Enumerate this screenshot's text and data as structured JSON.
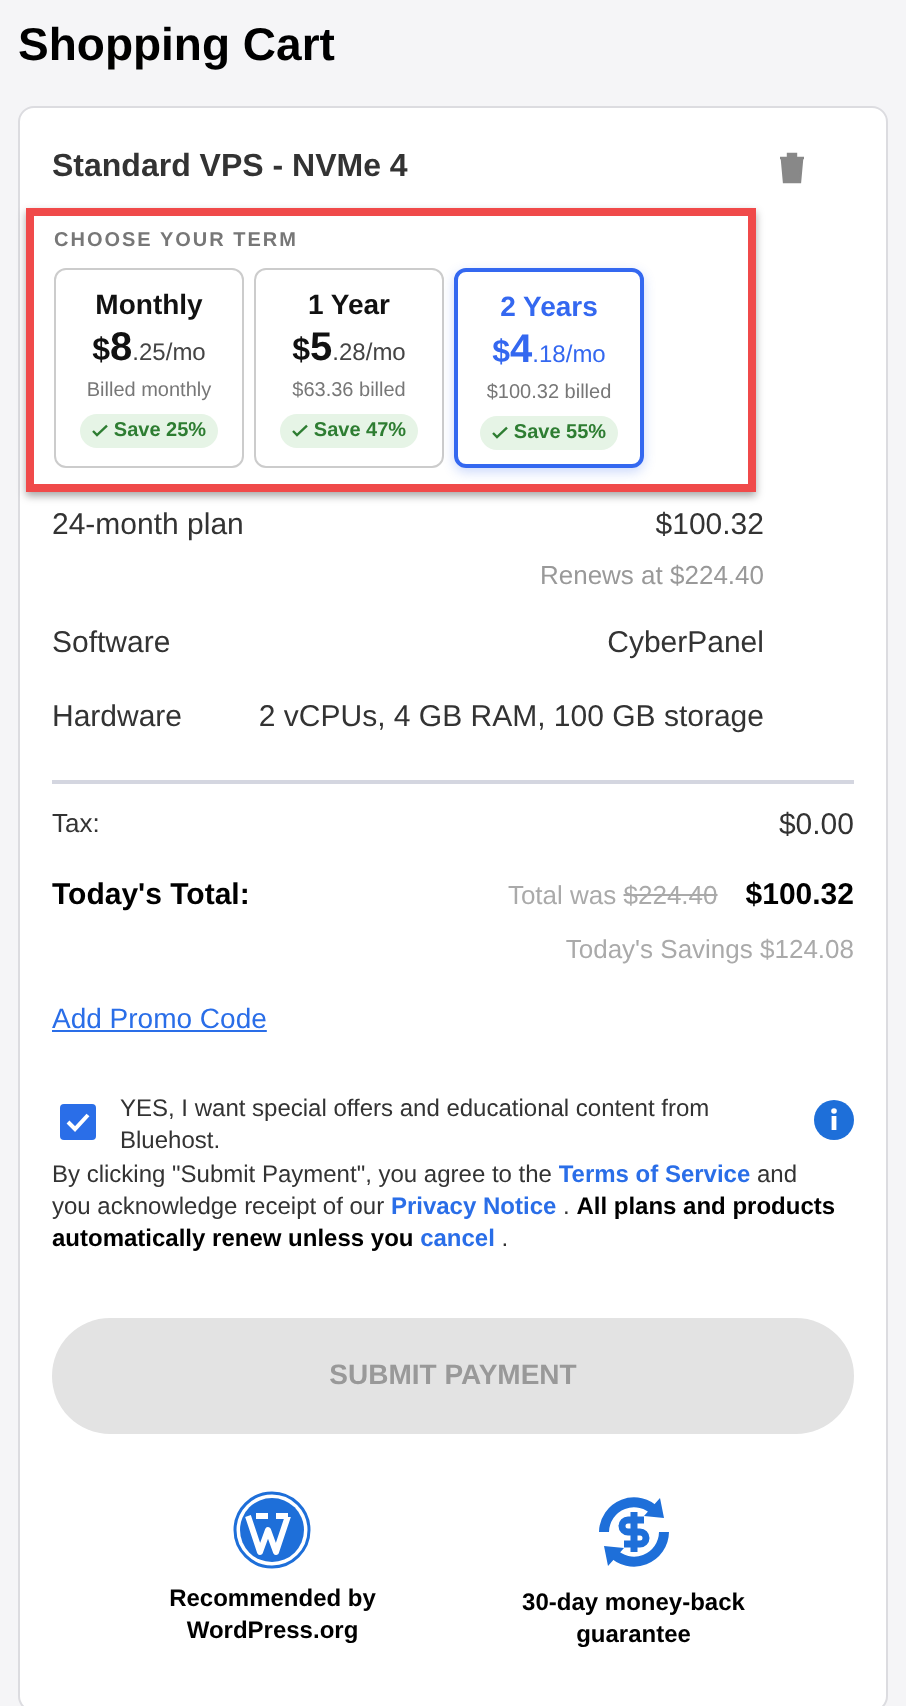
{
  "title": "Shopping Cart",
  "product": {
    "name": "Standard VPS - NVMe 4"
  },
  "term": {
    "heading": "CHOOSE YOUR TERM",
    "options": [
      {
        "label": "Monthly",
        "currency": "$",
        "whole": "8",
        "fraction": ".25/mo",
        "billed": "Billed monthly",
        "save": "Save 25%",
        "selected": false
      },
      {
        "label": "1 Year",
        "currency": "$",
        "whole": "5",
        "fraction": ".28/mo",
        "billed": "$63.36 billed",
        "save": "Save 47%",
        "selected": false
      },
      {
        "label": "2 Years",
        "currency": "$",
        "whole": "4",
        "fraction": ".18/mo",
        "billed": "$100.32 billed",
        "save": "Save 55%",
        "selected": true
      }
    ]
  },
  "plan": {
    "label": "24-month plan",
    "price": "$100.32",
    "renews": "Renews at $224.40"
  },
  "details": [
    {
      "label": "Software",
      "value": "CyberPanel"
    },
    {
      "label": "Hardware",
      "value": "2 vCPUs, 4 GB RAM, 100 GB storage"
    }
  ],
  "tax": {
    "label": "Tax:",
    "value": "$0.00"
  },
  "total": {
    "label": "Today's Total:",
    "was_label": "Total was",
    "was_value": "$224.40",
    "value": "$100.32",
    "savings": "Today's Savings $124.08"
  },
  "promo_link": "Add Promo Code",
  "offers": {
    "checked": true,
    "text": "YES, I want special offers and educational content from Bluehost."
  },
  "legal": [
    {
      "kind": "text",
      "text": "By clicking \"Submit Payment\", you agree to the"
    },
    {
      "kind": "link",
      "text": "Terms of Service"
    },
    {
      "kind": "text",
      "text": "and you acknowledge receipt of our"
    },
    {
      "kind": "link",
      "text": "Privacy Notice"
    },
    {
      "kind": "text",
      "text": "."
    },
    {
      "kind": "bold",
      "text": "All plans and products automatically renew unless you"
    },
    {
      "kind": "link",
      "text": "cancel"
    },
    {
      "kind": "text",
      "text": "."
    }
  ],
  "submit": {
    "label": "SUBMIT PAYMENT",
    "disabled": true
  },
  "badges": [
    {
      "kind": "wordpress",
      "text": "Recommended by WordPress.org"
    },
    {
      "kind": "money",
      "text": "30-day money-back guarantee"
    }
  ]
}
